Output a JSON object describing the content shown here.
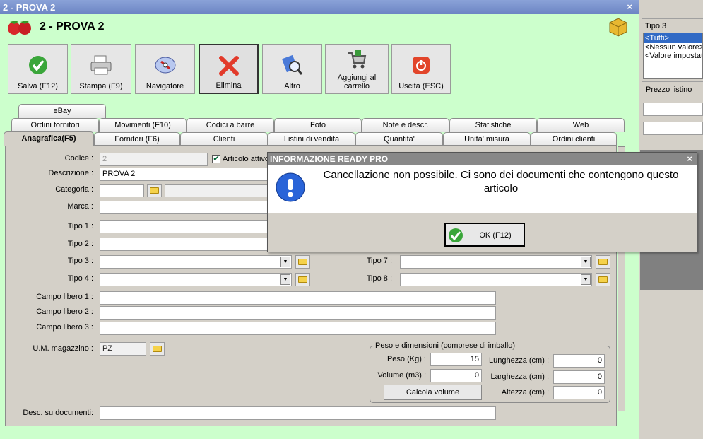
{
  "window": {
    "title": "2 - PROVA 2",
    "header": "2 - PROVA 2",
    "close": "×"
  },
  "toolbar": [
    {
      "label": "Salva (F12)",
      "icon": "check-icon"
    },
    {
      "label": "Stampa (F9)",
      "icon": "printer-icon"
    },
    {
      "label": "Navigatore",
      "icon": "compass-icon"
    },
    {
      "label": "Elimina",
      "icon": "delete-x-icon"
    },
    {
      "label": "Altro",
      "icon": "magnifier-icon"
    },
    {
      "label": "Aggiungi al carrello",
      "icon": "cart-icon"
    },
    {
      "label": "Uscita (ESC)",
      "icon": "power-icon"
    }
  ],
  "tabs": {
    "row1": [
      "eBay"
    ],
    "row2": [
      "Ordini fornitori",
      "Movimenti (F10)",
      "Codici a barre",
      "Foto",
      "Note e descr.",
      "Statistiche",
      "Web"
    ],
    "row3": [
      "Anagrafica(F5)",
      "Fornitori (F6)",
      "Clienti",
      "Listini di vendita",
      "Quantita'",
      "Unita' misura",
      "Ordini clienti"
    ]
  },
  "form": {
    "codice_label": "Codice :",
    "codice_value": "2",
    "articolo_attivo": "Articolo attivo",
    "descrizione_label": "Descrizione :",
    "descrizione_value": "PROVA 2",
    "categoria_label": "Categoria :",
    "marca_label": "Marca :",
    "tipo1": "Tipo 1 :",
    "tipo2": "Tipo 2 :",
    "tipo3": "Tipo 3 :",
    "tipo4": "Tipo 4 :",
    "tipo7": "Tipo 7 :",
    "tipo8": "Tipo 8 :",
    "campo1": "Campo libero 1 :",
    "campo2": "Campo libero 2 :",
    "campo3": "Campo libero 3 :",
    "um_label": "U.M. magazzino :",
    "um_value": "PZ",
    "peso_group": "Peso e dimensioni (comprese di imballo)",
    "peso_label": "Peso (Kg) :",
    "peso_value": "15",
    "volume_label": "Volume (m3) :",
    "volume_value": "0",
    "calcola": "Calcola volume",
    "lunghezza_label": "Lunghezza (cm) :",
    "lunghezza_value": "0",
    "larghezza_label": "Larghezza (cm) :",
    "larghezza_value": "0",
    "altezza_label": "Altezza (cm) :",
    "altezza_value": "0",
    "desc_doc_label": "Desc. su documenti:"
  },
  "right": {
    "tipo3_label": "Tipo 3",
    "options": [
      "<Tutti>",
      "<Nessun valore>",
      "<Valore impostato>"
    ],
    "prezzo_label": "Prezzo listino"
  },
  "dialog": {
    "title": "INFORMAZIONE READY PRO",
    "close": "×",
    "message": "Cancellazione non possibile. Ci sono dei documenti che contengono questo articolo",
    "ok": "OK (F12)"
  }
}
